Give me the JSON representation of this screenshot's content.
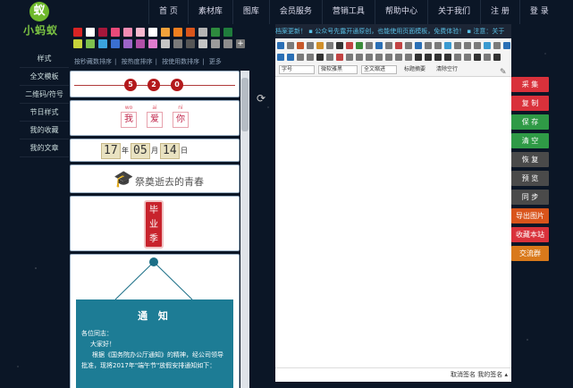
{
  "logo": {
    "mark": "蚁",
    "text": "小蚂蚁"
  },
  "nav": [
    "首 页",
    "素材库",
    "图库",
    "会员服务",
    "营销工具",
    "帮助中心",
    "关于我们",
    "注 册",
    "登 录"
  ],
  "left_menu": [
    "样式",
    "全文模板",
    "二维码/符号",
    "节日样式",
    "我的收藏",
    "我的文章"
  ],
  "palette": {
    "row1": [
      "#d82424",
      "#ffffff",
      "#a6173b",
      "#e84a7a",
      "#f28cb4",
      "#f5b9cf",
      "#ffffff",
      "#f1a23b",
      "#f07f1f",
      "#d9551b",
      "#b4b4b4",
      "#2e8b3e",
      "#1f7c3c"
    ],
    "row2": [
      "#c7d23b",
      "#7ec04e",
      "#3aa3dd",
      "#3a6fd0",
      "#9d64c7",
      "#b04fa8",
      "#e07dcf",
      "#c5c5c5",
      "#7a7a7a",
      "#555555",
      "#c3c3c3",
      "#9b9b9b",
      "#8c8c8c"
    ]
  },
  "sort_bar": [
    "按秒藏数排序",
    "按热度排序",
    "按使用数排序",
    "更多"
  ],
  "templates": {
    "t1_circles": [
      "5",
      "2",
      "0"
    ],
    "t2_pinyin": [
      "wo",
      "ai",
      "ni"
    ],
    "t2_hanzi": [
      "我",
      "爱",
      "你"
    ],
    "t3_date": {
      "yy": "17",
      "y_unit": "年",
      "mm": "05",
      "m_unit": "月",
      "dd": "14",
      "d_unit": "日"
    },
    "t4_text": "祭奠逝去的青春",
    "t5_text": [
      "毕",
      "业",
      "季"
    ],
    "t6_notice": {
      "title": "通 知",
      "greeting": "各位同志：",
      "hello": "大家好！",
      "body": "根据《国务院办公厅通知》的精神，经公司领导批准，现将2017年\"端午节\"放假安排通知如下："
    }
  },
  "editor": {
    "marquee": "档案更新！  ▪ 公众号先露开通原创，也能使用页面模板，免费体验！  ▪ 注意：关于",
    "font_size": "字号",
    "font_family": "微软雅黑",
    "indent": "全文缩进",
    "title_btn": "标题摘要",
    "clear_btn": "清除空行",
    "footer": "取消签名 我的签名 ▴"
  },
  "right_buttons": [
    {
      "label": "采 集",
      "color": "#d9313b"
    },
    {
      "label": "复 制",
      "color": "#d9313b"
    },
    {
      "label": "保 存",
      "color": "#2f9a46"
    },
    {
      "label": "清 空",
      "color": "#2f9a46"
    },
    {
      "label": "恢 复",
      "color": "#4a4a4a"
    },
    {
      "label": "预 览",
      "color": "#4a4a4a"
    },
    {
      "label": "同 步",
      "color": "#4a4a4a"
    },
    {
      "label": "导出图片",
      "color": "#d9541b"
    },
    {
      "label": "收藏本站",
      "color": "#d9313b"
    },
    {
      "label": "交流群",
      "color": "#d9791b"
    }
  ]
}
